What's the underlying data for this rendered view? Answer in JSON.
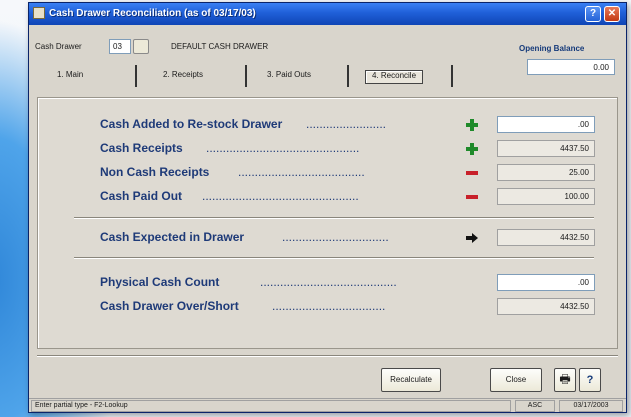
{
  "window": {
    "title": "Cash Drawer Reconciliation (as of 03/17/03)",
    "help_symbol": "?",
    "close_symbol": "✕"
  },
  "header": {
    "cash_drawer_label": "Cash Drawer",
    "cash_drawer_value": "03",
    "drawer_name": "DEFAULT CASH DRAWER",
    "opening_balance_label": "Opening Balance",
    "opening_balance_value": "0.00"
  },
  "tabs": [
    {
      "label": "1. Main",
      "active": false
    },
    {
      "label": "2. Receipts",
      "active": false
    },
    {
      "label": "3. Paid Outs",
      "active": false
    },
    {
      "label": "4. Reconcile",
      "active": true
    }
  ],
  "rows": {
    "cash_added": {
      "label": "Cash Added to Re-stock Drawer",
      "dots": "........................",
      "sign": "plus",
      "value": ".00"
    },
    "cash_receipts": {
      "label": "Cash Receipts",
      "dots": "..............................................",
      "sign": "plus",
      "value": "4437.50"
    },
    "non_cash_receipts": {
      "label": "Non Cash Receipts",
      "dots": "......................................",
      "sign": "minus",
      "value": "25.00"
    },
    "cash_paid_out": {
      "label": "Cash Paid Out",
      "dots": "...............................................",
      "sign": "minus",
      "value": "100.00"
    },
    "cash_expected": {
      "label": "Cash Expected in Drawer",
      "dots": "................................",
      "sign": "arrow",
      "value": "4432.50"
    },
    "physical_count": {
      "label": "Physical Cash Count",
      "dots": ".........................................",
      "value": ".00"
    },
    "over_short": {
      "label": "Cash Drawer Over/Short",
      "dots": "..................................",
      "value": "4432.50"
    }
  },
  "buttons": {
    "recalculate": "Recalculate",
    "close": "Close",
    "print_icon": "🖶",
    "help": "?"
  },
  "status": {
    "hint": "Enter partial type - F2-Lookup",
    "mode": "ASC",
    "date": "03/17/2003"
  },
  "colors": {
    "titlebar": "#1f5fd8",
    "label_text": "#1e3a78",
    "plus": "#1f8a2a",
    "minus": "#c8202a"
  }
}
